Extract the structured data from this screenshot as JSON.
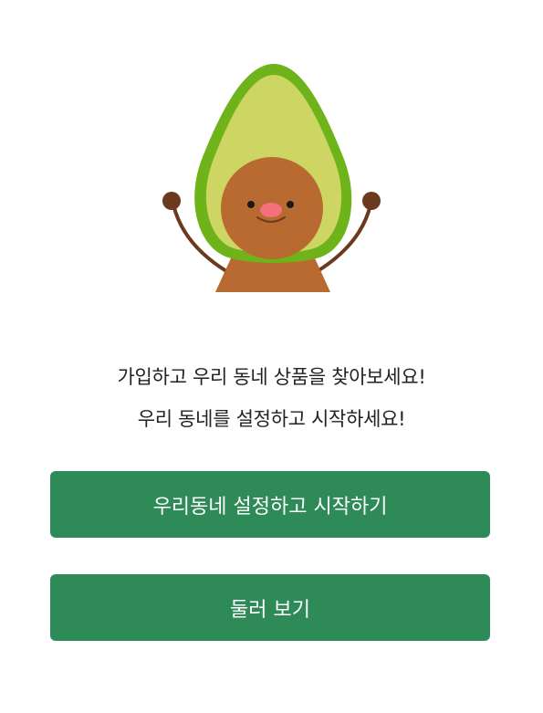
{
  "mascot": {
    "icon": "avocado-mascot-icon"
  },
  "intro": {
    "line1": "가입하고 우리 동네 상품을 찾아보세요!",
    "line2": "우리 동네를 설정하고 시작하세요!"
  },
  "actions": {
    "start_label": "우리동네 설정하고 시작하기",
    "browse_label": "둘러 보기"
  },
  "colors": {
    "primary": "#2e8b57",
    "avocado_skin": "#6fb31a",
    "avocado_flesh": "#cdd563",
    "pit": "#b86a30"
  }
}
